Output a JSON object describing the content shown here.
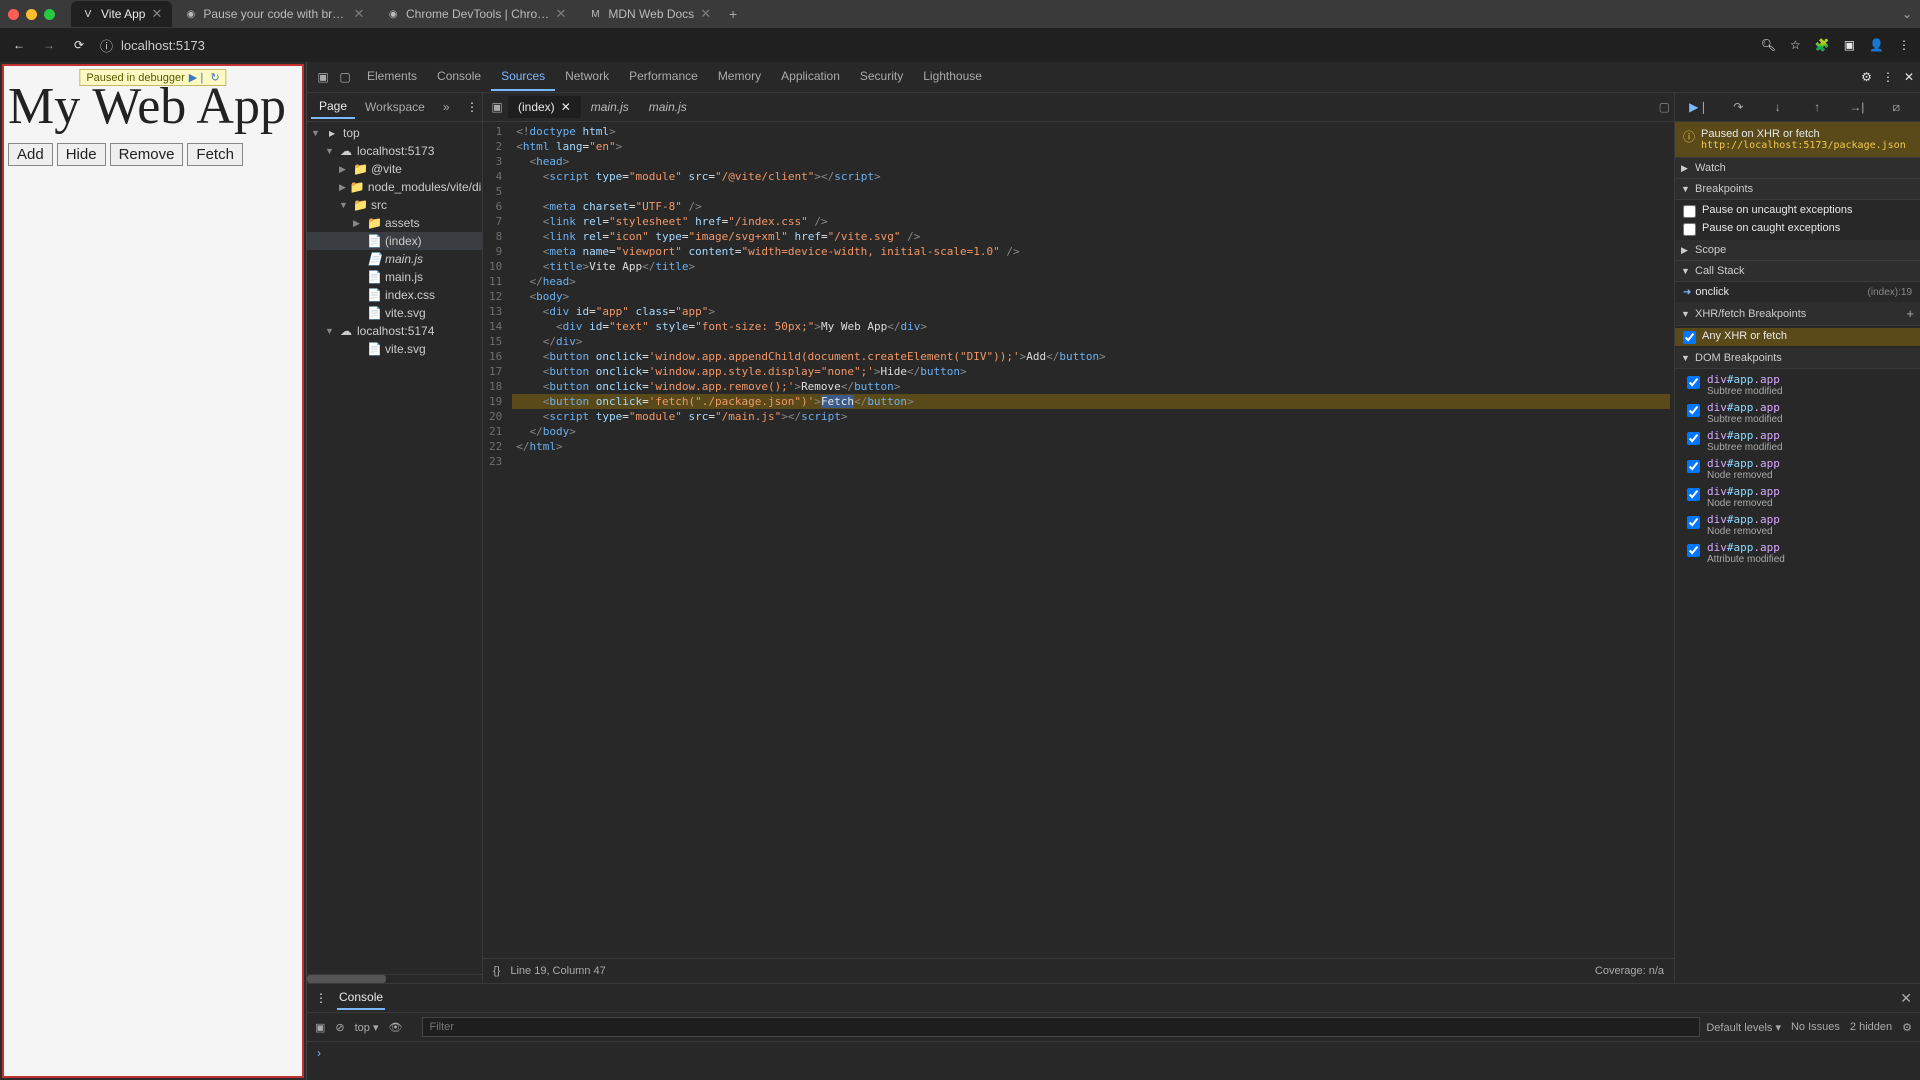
{
  "browser": {
    "tabs": [
      {
        "favicon": "V",
        "title": "Vite App",
        "active": true
      },
      {
        "favicon": "",
        "title": "Pause your code with breakp"
      },
      {
        "favicon": "",
        "title": "Chrome DevTools | Chrome"
      },
      {
        "favicon": "M",
        "title": "MDN Web Docs"
      }
    ],
    "url": "localhost:5173"
  },
  "page": {
    "paused_badge": "Paused in debugger",
    "heading": "My Web App",
    "buttons": [
      "Add",
      "Hide",
      "Remove",
      "Fetch"
    ],
    "border_color": "#c03030"
  },
  "devtools": {
    "tabs": [
      "Elements",
      "Console",
      "Sources",
      "Network",
      "Performance",
      "Memory",
      "Application",
      "Security",
      "Lighthouse"
    ],
    "active_tab": "Sources",
    "nav_tabs": [
      "Page",
      "Workspace"
    ],
    "file_tree": {
      "top": "top",
      "host1": "localhost:5173",
      "node_modules": "node_modules/vite/di",
      "src": "src",
      "assets": "assets",
      "vite_dir": "@vite",
      "files": [
        "(index)",
        "main.js",
        "main.js",
        "index.css",
        "vite.svg"
      ],
      "host2": "localhost:5174",
      "files2": [
        "vite.svg"
      ]
    },
    "editor_tabs": [
      {
        "label": "(index)",
        "active": true,
        "closable": true
      },
      {
        "label": "main.js",
        "italic": true
      },
      {
        "label": "main.js",
        "italic": true
      }
    ],
    "status": "Line 19, Column 47",
    "coverage": "Coverage: n/a"
  },
  "code": [
    {
      "n": 1,
      "html": "<span class='punct'>&lt;!</span><span class='tag'>doctype</span> <span class='attr'>html</span><span class='punct'>&gt;</span>"
    },
    {
      "n": 2,
      "html": "<span class='punct'>&lt;</span><span class='tag'>html</span> <span class='attr'>lang</span>=<span class='str'>\"en\"</span><span class='punct'>&gt;</span>"
    },
    {
      "n": 3,
      "html": "  <span class='punct'>&lt;</span><span class='tag'>head</span><span class='punct'>&gt;</span>"
    },
    {
      "n": 4,
      "html": "    <span class='punct'>&lt;</span><span class='tag'>script</span> <span class='attr'>type</span>=<span class='str'>\"module\"</span> <span class='attr'>src</span>=<span class='str'>\"/@vite/client\"</span><span class='punct'>&gt;&lt;/</span><span class='tag'>script</span><span class='punct'>&gt;</span>"
    },
    {
      "n": 5,
      "html": ""
    },
    {
      "n": 6,
      "html": "    <span class='punct'>&lt;</span><span class='tag'>meta</span> <span class='attr'>charset</span>=<span class='str'>\"UTF-8\"</span> <span class='punct'>/&gt;</span>"
    },
    {
      "n": 7,
      "html": "    <span class='punct'>&lt;</span><span class='tag'>link</span> <span class='attr'>rel</span>=<span class='str'>\"stylesheet\"</span> <span class='attr'>href</span>=<span class='str'>\"/index.css\"</span> <span class='punct'>/&gt;</span>"
    },
    {
      "n": 8,
      "html": "    <span class='punct'>&lt;</span><span class='tag'>link</span> <span class='attr'>rel</span>=<span class='str'>\"icon\"</span> <span class='attr'>type</span>=<span class='str'>\"image/svg+xml\"</span> <span class='attr'>href</span>=<span class='str'>\"/vite.svg\"</span> <span class='punct'>/&gt;</span>"
    },
    {
      "n": 9,
      "html": "    <span class='punct'>&lt;</span><span class='tag'>meta</span> <span class='attr'>name</span>=<span class='str'>\"viewport\"</span> <span class='attr'>content</span>=<span class='str'>\"width=device-width, initial-scale=1.0\"</span> <span class='punct'>/&gt;</span>"
    },
    {
      "n": 10,
      "html": "    <span class='punct'>&lt;</span><span class='tag'>title</span><span class='punct'>&gt;</span><span class='txt'>Vite App</span><span class='punct'>&lt;/</span><span class='tag'>title</span><span class='punct'>&gt;</span>"
    },
    {
      "n": 11,
      "html": "  <span class='punct'>&lt;/</span><span class='tag'>head</span><span class='punct'>&gt;</span>"
    },
    {
      "n": 12,
      "html": "  <span class='punct'>&lt;</span><span class='tag'>body</span><span class='punct'>&gt;</span>"
    },
    {
      "n": 13,
      "html": "    <span class='punct'>&lt;</span><span class='tag'>div</span> <span class='attr'>id</span>=<span class='str'>\"app\"</span> <span class='attr'>class</span>=<span class='str'>\"app\"</span><span class='punct'>&gt;</span>"
    },
    {
      "n": 14,
      "html": "      <span class='punct'>&lt;</span><span class='tag'>div</span> <span class='attr'>id</span>=<span class='str'>\"text\"</span> <span class='attr'>style</span>=<span class='str'>\"font-size: 50px;\"</span><span class='punct'>&gt;</span><span class='txt'>My Web App</span><span class='punct'>&lt;/</span><span class='tag'>div</span><span class='punct'>&gt;</span>"
    },
    {
      "n": 15,
      "html": "    <span class='punct'>&lt;/</span><span class='tag'>div</span><span class='punct'>&gt;</span>"
    },
    {
      "n": 16,
      "html": "    <span class='punct'>&lt;</span><span class='tag'>button</span> <span class='attr'>onclick</span>=<span class='str'>'window.app.appendChild(document.createElement(\"DIV\"));'</span><span class='punct'>&gt;</span><span class='txt'>Add</span><span class='punct'>&lt;/</span><span class='tag'>button</span><span class='punct'>&gt;</span>"
    },
    {
      "n": 17,
      "html": "    <span class='punct'>&lt;</span><span class='tag'>button</span> <span class='attr'>onclick</span>=<span class='str'>'window.app.style.display=\"none\";'</span><span class='punct'>&gt;</span><span class='txt'>Hide</span><span class='punct'>&lt;/</span><span class='tag'>button</span><span class='punct'>&gt;</span>"
    },
    {
      "n": 18,
      "html": "    <span class='punct'>&lt;</span><span class='tag'>button</span> <span class='attr'>onclick</span>=<span class='str'>'window.app.remove();'</span><span class='punct'>&gt;</span><span class='txt'>Remove</span><span class='punct'>&lt;/</span><span class='tag'>button</span><span class='punct'>&gt;</span>"
    },
    {
      "n": 19,
      "hl": true,
      "html": "    <span class='punct'>&lt;</span><span class='tag'>button</span> <span class='attr'>onclick</span>=<span class='str'>'fetch(\"./package.json\")'</span><span class='punct'>&gt;</span><span style='background:#3a5a8a'>Fetch</span><span class='punct'>&lt;/</span><span class='tag'>button</span><span class='punct'>&gt;</span>"
    },
    {
      "n": 20,
      "html": "    <span class='punct'>&lt;</span><span class='tag'>script</span> <span class='attr'>type</span>=<span class='str'>\"module\"</span> <span class='attr'>src</span>=<span class='str'>\"/main.js\"</span><span class='punct'>&gt;&lt;/</span><span class='tag'>script</span><span class='punct'>&gt;</span>"
    },
    {
      "n": 21,
      "html": "  <span class='punct'>&lt;/</span><span class='tag'>body</span><span class='punct'>&gt;</span>"
    },
    {
      "n": 22,
      "html": "<span class='punct'>&lt;/</span><span class='tag'>html</span><span class='punct'>&gt;</span>"
    },
    {
      "n": 23,
      "html": ""
    }
  ],
  "debugger": {
    "paused_title": "Paused on XHR or fetch",
    "paused_url": "http://localhost:5173/package.json",
    "sections": {
      "watch": "Watch",
      "breakpoints": "Breakpoints",
      "scope": "Scope",
      "callstack": "Call Stack",
      "xhr": "XHR/fetch Breakpoints",
      "dom": "DOM Breakpoints"
    },
    "breakpoints": [
      {
        "checked": false,
        "label": "Pause on uncaught exceptions"
      },
      {
        "checked": false,
        "label": "Pause on caught exceptions"
      }
    ],
    "callstack": [
      {
        "name": "onclick",
        "location": "(index):19"
      }
    ],
    "xhr_breakpoints": [
      {
        "checked": true,
        "label": "Any XHR or fetch",
        "hl": true
      }
    ],
    "dom_breakpoints": [
      {
        "node": "div#app.app",
        "type": "Subtree modified"
      },
      {
        "node": "div#app.app",
        "type": "Subtree modified"
      },
      {
        "node": "div#app.app",
        "type": "Subtree modified"
      },
      {
        "node": "div#app.app",
        "type": "Node removed"
      },
      {
        "node": "div#app.app",
        "type": "Node removed"
      },
      {
        "node": "div#app.app",
        "type": "Node removed"
      },
      {
        "node": "div#app.app",
        "type": "Attribute modified"
      }
    ]
  },
  "console": {
    "tab": "Console",
    "context": "top",
    "filter_placeholder": "Filter",
    "levels": "Default levels",
    "issues": "No Issues",
    "hidden": "2 hidden",
    "prompt": "›"
  }
}
